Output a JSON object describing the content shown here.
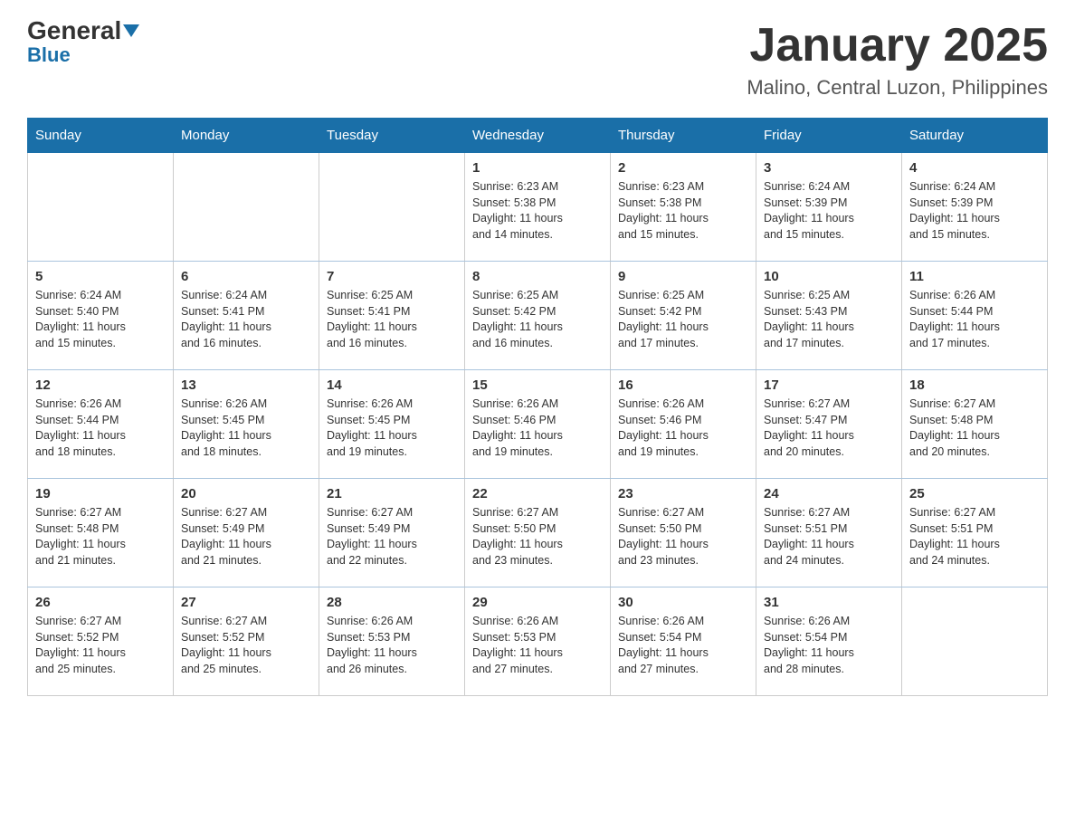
{
  "header": {
    "logo_general": "General",
    "logo_blue": "Blue",
    "title": "January 2025",
    "subtitle": "Malino, Central Luzon, Philippines"
  },
  "days_of_week": [
    "Sunday",
    "Monday",
    "Tuesday",
    "Wednesday",
    "Thursday",
    "Friday",
    "Saturday"
  ],
  "weeks": [
    [
      {
        "day": "",
        "info": ""
      },
      {
        "day": "",
        "info": ""
      },
      {
        "day": "",
        "info": ""
      },
      {
        "day": "1",
        "info": "Sunrise: 6:23 AM\nSunset: 5:38 PM\nDaylight: 11 hours\nand 14 minutes."
      },
      {
        "day": "2",
        "info": "Sunrise: 6:23 AM\nSunset: 5:38 PM\nDaylight: 11 hours\nand 15 minutes."
      },
      {
        "day": "3",
        "info": "Sunrise: 6:24 AM\nSunset: 5:39 PM\nDaylight: 11 hours\nand 15 minutes."
      },
      {
        "day": "4",
        "info": "Sunrise: 6:24 AM\nSunset: 5:39 PM\nDaylight: 11 hours\nand 15 minutes."
      }
    ],
    [
      {
        "day": "5",
        "info": "Sunrise: 6:24 AM\nSunset: 5:40 PM\nDaylight: 11 hours\nand 15 minutes."
      },
      {
        "day": "6",
        "info": "Sunrise: 6:24 AM\nSunset: 5:41 PM\nDaylight: 11 hours\nand 16 minutes."
      },
      {
        "day": "7",
        "info": "Sunrise: 6:25 AM\nSunset: 5:41 PM\nDaylight: 11 hours\nand 16 minutes."
      },
      {
        "day": "8",
        "info": "Sunrise: 6:25 AM\nSunset: 5:42 PM\nDaylight: 11 hours\nand 16 minutes."
      },
      {
        "day": "9",
        "info": "Sunrise: 6:25 AM\nSunset: 5:42 PM\nDaylight: 11 hours\nand 17 minutes."
      },
      {
        "day": "10",
        "info": "Sunrise: 6:25 AM\nSunset: 5:43 PM\nDaylight: 11 hours\nand 17 minutes."
      },
      {
        "day": "11",
        "info": "Sunrise: 6:26 AM\nSunset: 5:44 PM\nDaylight: 11 hours\nand 17 minutes."
      }
    ],
    [
      {
        "day": "12",
        "info": "Sunrise: 6:26 AM\nSunset: 5:44 PM\nDaylight: 11 hours\nand 18 minutes."
      },
      {
        "day": "13",
        "info": "Sunrise: 6:26 AM\nSunset: 5:45 PM\nDaylight: 11 hours\nand 18 minutes."
      },
      {
        "day": "14",
        "info": "Sunrise: 6:26 AM\nSunset: 5:45 PM\nDaylight: 11 hours\nand 19 minutes."
      },
      {
        "day": "15",
        "info": "Sunrise: 6:26 AM\nSunset: 5:46 PM\nDaylight: 11 hours\nand 19 minutes."
      },
      {
        "day": "16",
        "info": "Sunrise: 6:26 AM\nSunset: 5:46 PM\nDaylight: 11 hours\nand 19 minutes."
      },
      {
        "day": "17",
        "info": "Sunrise: 6:27 AM\nSunset: 5:47 PM\nDaylight: 11 hours\nand 20 minutes."
      },
      {
        "day": "18",
        "info": "Sunrise: 6:27 AM\nSunset: 5:48 PM\nDaylight: 11 hours\nand 20 minutes."
      }
    ],
    [
      {
        "day": "19",
        "info": "Sunrise: 6:27 AM\nSunset: 5:48 PM\nDaylight: 11 hours\nand 21 minutes."
      },
      {
        "day": "20",
        "info": "Sunrise: 6:27 AM\nSunset: 5:49 PM\nDaylight: 11 hours\nand 21 minutes."
      },
      {
        "day": "21",
        "info": "Sunrise: 6:27 AM\nSunset: 5:49 PM\nDaylight: 11 hours\nand 22 minutes."
      },
      {
        "day": "22",
        "info": "Sunrise: 6:27 AM\nSunset: 5:50 PM\nDaylight: 11 hours\nand 23 minutes."
      },
      {
        "day": "23",
        "info": "Sunrise: 6:27 AM\nSunset: 5:50 PM\nDaylight: 11 hours\nand 23 minutes."
      },
      {
        "day": "24",
        "info": "Sunrise: 6:27 AM\nSunset: 5:51 PM\nDaylight: 11 hours\nand 24 minutes."
      },
      {
        "day": "25",
        "info": "Sunrise: 6:27 AM\nSunset: 5:51 PM\nDaylight: 11 hours\nand 24 minutes."
      }
    ],
    [
      {
        "day": "26",
        "info": "Sunrise: 6:27 AM\nSunset: 5:52 PM\nDaylight: 11 hours\nand 25 minutes."
      },
      {
        "day": "27",
        "info": "Sunrise: 6:27 AM\nSunset: 5:52 PM\nDaylight: 11 hours\nand 25 minutes."
      },
      {
        "day": "28",
        "info": "Sunrise: 6:26 AM\nSunset: 5:53 PM\nDaylight: 11 hours\nand 26 minutes."
      },
      {
        "day": "29",
        "info": "Sunrise: 6:26 AM\nSunset: 5:53 PM\nDaylight: 11 hours\nand 27 minutes."
      },
      {
        "day": "30",
        "info": "Sunrise: 6:26 AM\nSunset: 5:54 PM\nDaylight: 11 hours\nand 27 minutes."
      },
      {
        "day": "31",
        "info": "Sunrise: 6:26 AM\nSunset: 5:54 PM\nDaylight: 11 hours\nand 28 minutes."
      },
      {
        "day": "",
        "info": ""
      }
    ]
  ]
}
